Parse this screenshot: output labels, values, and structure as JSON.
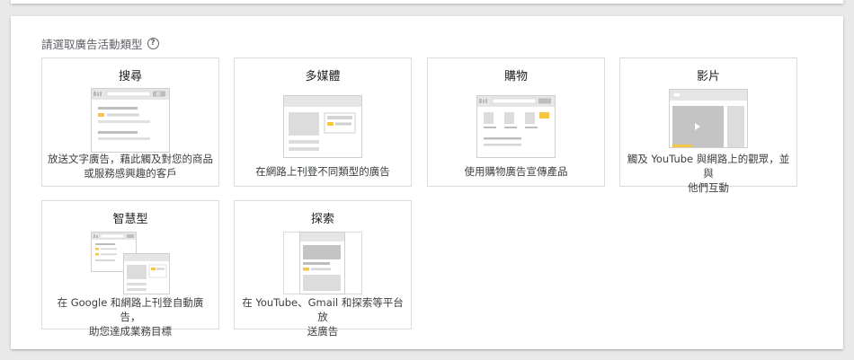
{
  "heading": "請選取廣告活動類型",
  "help_icon": "help-circle-icon",
  "colors": {
    "accent": "#f7c443",
    "border": "#dadce0",
    "mock_gray": "#d5d5d5",
    "mock_light": "#eeeeee"
  },
  "cards": [
    {
      "id": "search",
      "title": "搜尋",
      "desc": [
        "放送文字廣告，藉此觸及對您的商品",
        "或服務感興趣的客戶"
      ]
    },
    {
      "id": "display",
      "title": "多媒體",
      "desc": [
        "在網路上刊登不同類型的廣告"
      ]
    },
    {
      "id": "shopping",
      "title": "購物",
      "desc": [
        "使用購物廣告宣傳產品"
      ]
    },
    {
      "id": "video",
      "title": "影片",
      "desc": [
        "觸及 YouTube 與網路上的觀眾，並與",
        "他們互動"
      ]
    },
    {
      "id": "smart",
      "title": "智慧型",
      "desc": [
        "在 Google 和網路上刊登自動廣告，",
        "助您達成業務目標"
      ]
    },
    {
      "id": "discovery",
      "title": "探索",
      "desc": [
        "在 YouTube、Gmail 和探索等平台放",
        "送廣告"
      ]
    }
  ]
}
